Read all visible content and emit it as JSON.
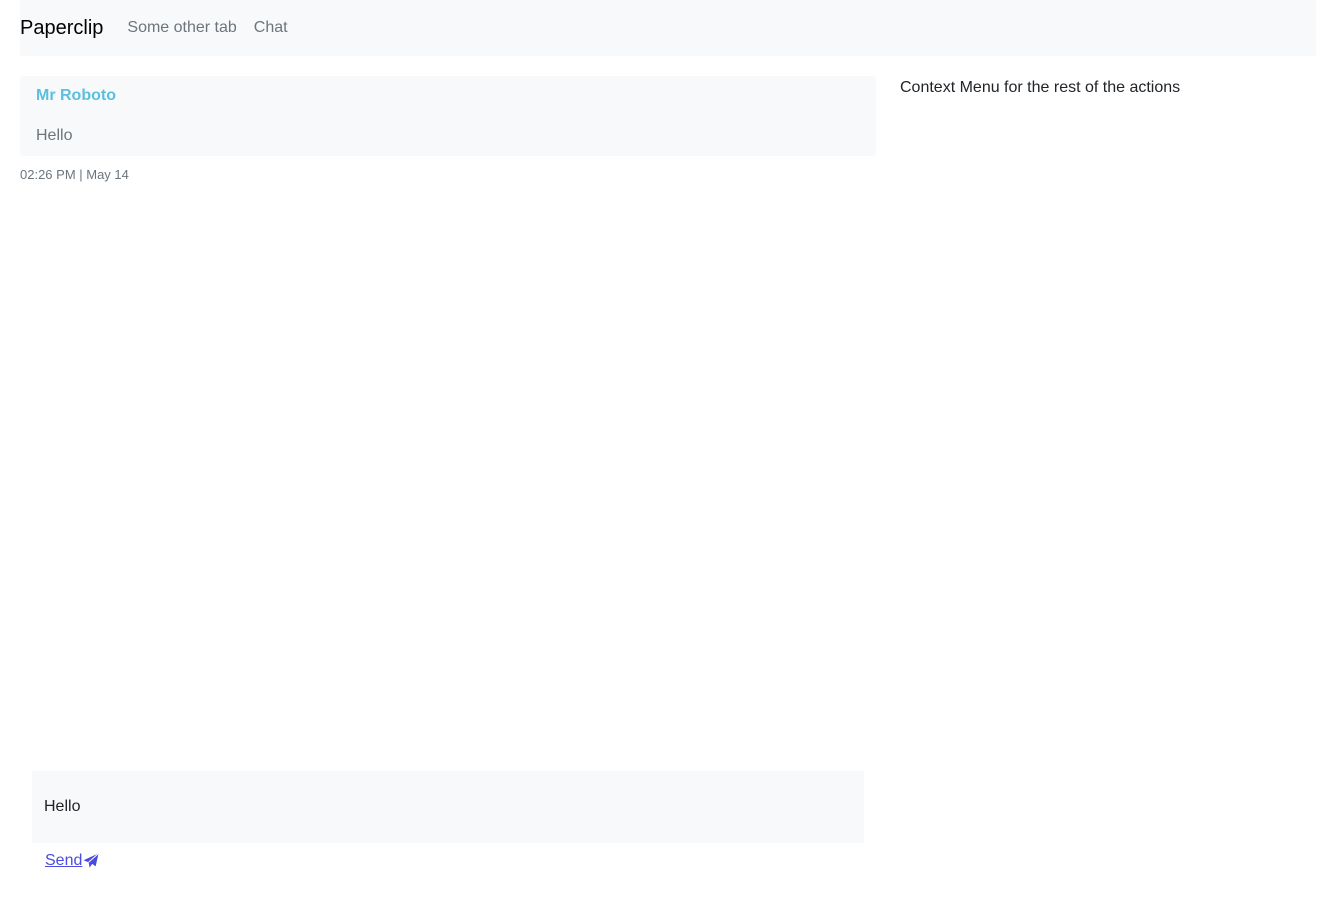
{
  "navbar": {
    "brand": "Paperclip",
    "tabs": [
      {
        "label": "Some other tab"
      },
      {
        "label": "Chat"
      }
    ]
  },
  "chat": {
    "messages": [
      {
        "sender": "Mr Roboto",
        "text": "Hello",
        "timestamp": "02:26 PM | May 14"
      }
    ],
    "composer": {
      "value": "Hello"
    },
    "send_label": "Send",
    "send_icon": "paper-plane-icon"
  },
  "sidebar": {
    "text": "Context Menu for the rest of the actions"
  },
  "colors": {
    "sender": "#5bc0de",
    "link": "#4b4bdd",
    "panel_bg": "#f8f9fa"
  }
}
